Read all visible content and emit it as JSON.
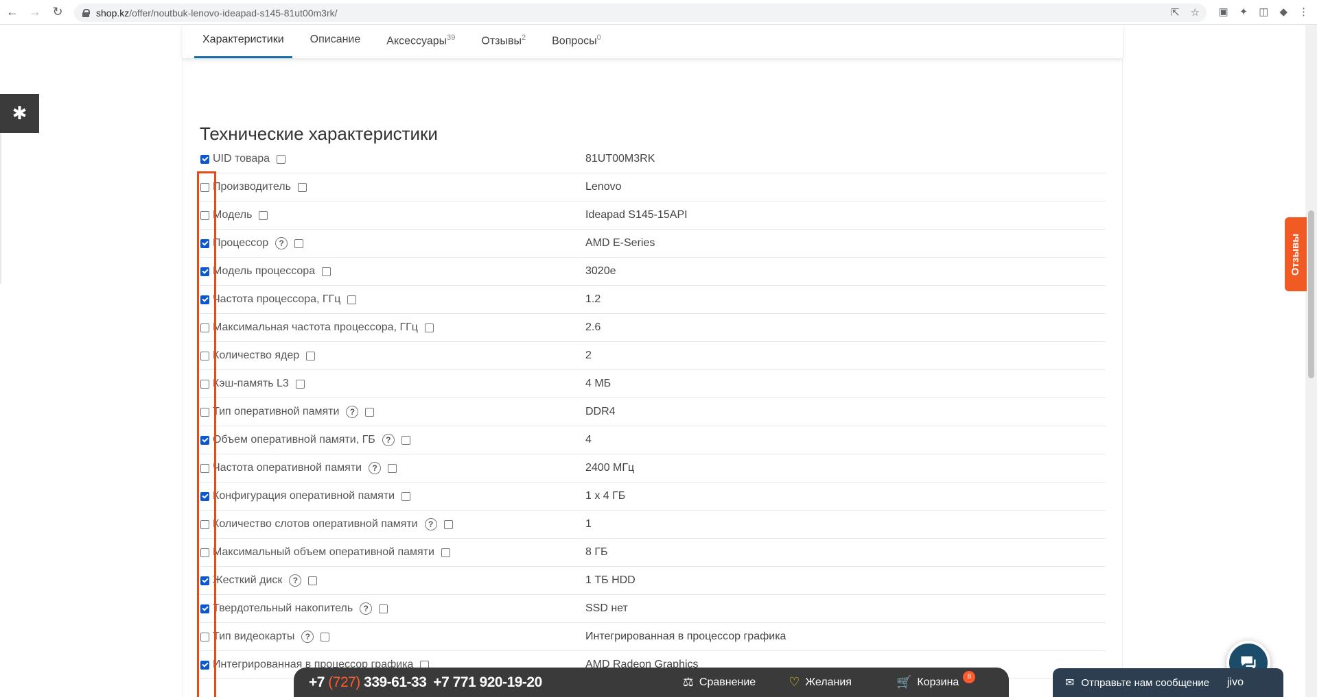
{
  "browser": {
    "url_host": "shop.kz",
    "url_path": "/offer/noutbuk-lenovo-ideapad-s145-81ut00m3rk/"
  },
  "tabs": [
    {
      "label": "Характеристики",
      "count": ""
    },
    {
      "label": "Описание",
      "count": ""
    },
    {
      "label": "Аксессуары",
      "count": "39"
    },
    {
      "label": "Отзывы",
      "count": "2"
    },
    {
      "label": "Вопросы",
      "count": "0"
    }
  ],
  "spec_section": {
    "title": "Технические характеристики",
    "rows": [
      {
        "name": "UID товара",
        "value": "81UT00M3RK",
        "checked": true,
        "help": false
      },
      {
        "name": "Производитель",
        "value": "Lenovo",
        "checked": false,
        "help": false
      },
      {
        "name": "Модель",
        "value": "Ideapad S145-15API",
        "checked": false,
        "help": false
      },
      {
        "name": "Процессор",
        "value": "AMD E-Series",
        "checked": true,
        "help": true
      },
      {
        "name": "Модель процессора",
        "value": "3020e",
        "checked": true,
        "help": false
      },
      {
        "name": "Частота процессора, ГГц",
        "value": "1.2",
        "checked": true,
        "help": false
      },
      {
        "name": "Максимальная частота процессора, ГГц",
        "value": "2.6",
        "checked": false,
        "help": false
      },
      {
        "name": "Количество ядер",
        "value": "2",
        "checked": false,
        "help": false
      },
      {
        "name": "Кэш-память L3",
        "value": "4 МБ",
        "checked": false,
        "help": false
      },
      {
        "name": "Тип оперативной памяти",
        "value": "DDR4",
        "checked": false,
        "help": true
      },
      {
        "name": "Объем оперативной памяти, ГБ",
        "value": "4",
        "checked": true,
        "help": true
      },
      {
        "name": "Частота оперативной памяти",
        "value": "2400 МГц",
        "checked": false,
        "help": true
      },
      {
        "name": "Конфигурация оперативной памяти",
        "value": "1 x 4 ГБ",
        "checked": true,
        "help": false
      },
      {
        "name": "Количество слотов оперативной памяти",
        "value": "1",
        "checked": false,
        "help": true
      },
      {
        "name": "Максимальный объем оперативной памяти",
        "value": "8 ГБ",
        "checked": false,
        "help": false
      },
      {
        "name": "Жесткий диск",
        "value": "1 ТБ HDD",
        "checked": true,
        "help": true
      },
      {
        "name": "Твердотельный накопитель",
        "value": "SSD нет",
        "checked": true,
        "help": true
      },
      {
        "name": "Тип видеокарты",
        "value": "Интегрированная в процессор графика",
        "checked": false,
        "help": true
      },
      {
        "name": "Интегрированная в процессор графика",
        "value": "AMD Radeon Graphics",
        "checked": true,
        "help": false
      }
    ]
  },
  "side_tab": {
    "label": "Отзывы"
  },
  "bottom_bar": {
    "phone1_prefix": "+7 ",
    "phone1_code": "(727)",
    "phone1_number": " 339-61-33",
    "phone2": "+7 771 920-19-20",
    "compare": "Сравнение",
    "wishlist": "Желания",
    "cart": "Корзина",
    "cart_count": "8"
  },
  "jivo": {
    "message": "Отправьте нам сообщение",
    "logo": "jivo"
  },
  "help_glyph": "?"
}
